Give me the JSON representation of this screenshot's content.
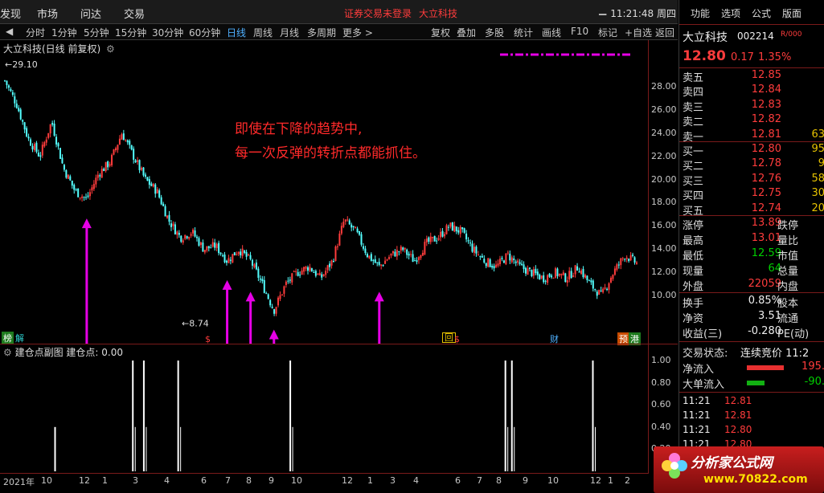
{
  "topbar": {
    "menus": [
      "发现",
      "市场",
      "问达",
      "交易"
    ],
    "notice_login": "证券交易未登录",
    "notice_stock": "大立科技",
    "clock": "11:21:48 周四"
  },
  "periodbar": {
    "periods": [
      "分时",
      "1分钟",
      "5分钟",
      "15分钟",
      "30分钟",
      "60分钟",
      "日线",
      "周线",
      "月线",
      "多周期",
      "更多 >"
    ],
    "active": "日线",
    "tools": [
      "复权",
      "叠加",
      "多股",
      "统计",
      "画线",
      "F10",
      "标记",
      "+自选",
      "返回"
    ]
  },
  "chart": {
    "title": "大立科技(日线 前复权)",
    "high_label": "29.10",
    "low_label": "8.74",
    "annotation_line1": "即使在下降的趋势中,",
    "annotation_line2": "每一次反弹的转折点都能抓住。",
    "yticks": [
      "28.00",
      "26.00",
      "24.00",
      "22.00",
      "20.00",
      "18.00",
      "16.00",
      "14.00",
      "12.00",
      "10.00"
    ],
    "sub_title": "建仓点副图  建仓点: 0.00",
    "sub_yticks": [
      "1.00",
      "0.80",
      "0.60",
      "0.40",
      "0.20"
    ],
    "xticks": [
      "2021年",
      "10",
      "12",
      "1",
      "3",
      "4",
      "6",
      "7",
      "8",
      "9",
      "10",
      "12",
      "1",
      "3",
      "4",
      "6",
      "7",
      "8",
      "9",
      "10",
      "12",
      "1",
      "2"
    ],
    "tags": {
      "left1": "榜",
      "left2": "解",
      "mid1": "$",
      "mid2": "回",
      "mid3": "$",
      "cai": "财",
      "yu": "预",
      "gang": "港"
    },
    "colors": {
      "up": "#ff3c3c",
      "down": "#54ffff",
      "arrow": "#e600e6",
      "annotation": "#ff2a2a"
    }
  },
  "chart_data": {
    "type": "line",
    "title": "大立科技(日线 前复权)",
    "xlabel": "",
    "ylabel": "",
    "ylim": [
      8.5,
      29.5
    ],
    "x_ticks": [
      "2021年",
      "10",
      "12",
      "1",
      "3",
      "4",
      "6",
      "7",
      "8",
      "9",
      "10",
      "12",
      "1",
      "3",
      "4",
      "6",
      "7",
      "8",
      "9",
      "10",
      "12",
      "1",
      "2"
    ],
    "price_path": [
      28.5,
      26.5,
      23.5,
      22.0,
      25.0,
      21.0,
      19.0,
      18.3,
      20.5,
      21.5,
      24.0,
      22.0,
      20.0,
      19.0,
      16.5,
      15.0,
      15.5,
      14.0,
      14.3,
      13.0,
      14.0,
      13.0,
      11.0,
      8.74,
      11.0,
      12.0,
      12.5,
      11.5,
      13.0,
      16.5,
      15.5,
      13.5,
      12.5,
      13.5,
      14.0,
      13.0,
      14.5,
      15.0,
      16.0,
      15.5,
      14.0,
      13.0,
      12.5,
      13.5,
      12.5,
      12.0,
      11.5,
      12.0,
      11.5,
      12.5,
      11.0,
      10.0,
      12.0,
      13.5,
      12.8
    ],
    "buy_signals": [
      {
        "bar": 7,
        "price": 18.3
      },
      {
        "bar": 19,
        "price": 13.0
      },
      {
        "bar": 21,
        "price": 12.0
      },
      {
        "bar": 23,
        "price": 8.74
      },
      {
        "bar": 32,
        "price": 12.0
      }
    ],
    "sub_chart_series": {
      "name": "建仓点",
      "spikes": [
        {
          "pos": 0.085,
          "value": 0.4
        },
        {
          "pos": 0.205,
          "value": 1.0
        },
        {
          "pos": 0.222,
          "value": 1.0
        },
        {
          "pos": 0.275,
          "value": 1.0
        },
        {
          "pos": 0.448,
          "value": 1.0
        },
        {
          "pos": 0.78,
          "value": 1.0
        },
        {
          "pos": 0.79,
          "value": 1.0
        },
        {
          "pos": 0.915,
          "value": 1.0
        }
      ]
    }
  },
  "rpanel": {
    "menus": [
      "功能",
      "选项",
      "公式",
      "版面"
    ],
    "stock_name": "大立科技",
    "stock_code": "002214",
    "price": "12.80",
    "change": "0.17",
    "change_pct": "1.35%",
    "asks": [
      {
        "label": "卖五",
        "price": "12.85",
        "vol": ""
      },
      {
        "label": "卖四",
        "price": "12.84",
        "vol": ""
      },
      {
        "label": "卖三",
        "price": "12.83",
        "vol": ""
      },
      {
        "label": "卖二",
        "price": "12.82",
        "vol": ""
      },
      {
        "label": "卖一",
        "price": "12.81",
        "vol": "63"
      }
    ],
    "bids": [
      {
        "label": "买一",
        "price": "12.80",
        "vol": "95"
      },
      {
        "label": "买二",
        "price": "12.78",
        "vol": "9"
      },
      {
        "label": "买三",
        "price": "12.76",
        "vol": "58"
      },
      {
        "label": "买四",
        "price": "12.75",
        "vol": "30"
      },
      {
        "label": "买五",
        "price": "12.74",
        "vol": "20"
      }
    ],
    "stats": [
      {
        "l1": "涨停",
        "v1": "13.89",
        "c1": "red",
        "l2": "跌停"
      },
      {
        "l1": "最高",
        "v1": "13.01",
        "c1": "red",
        "l2": "量比"
      },
      {
        "l1": "最低",
        "v1": "12.59",
        "c1": "green",
        "l2": "市值"
      },
      {
        "l1": "现量",
        "v1": "64",
        "c1": "green",
        "l2": "总量"
      },
      {
        "l1": "外盘",
        "v1": "22059",
        "c1": "red",
        "l2": "内盘"
      }
    ],
    "stats2": [
      {
        "l1": "换手",
        "v1": "0.85%",
        "l2": "股本"
      },
      {
        "l1": "净资",
        "v1": "3.51",
        "l2": "流通"
      },
      {
        "l1": "收益(三)",
        "v1": "-0.280",
        "l2": "PE(动)"
      }
    ],
    "trade_status_label": "交易状态:",
    "trade_status": "连续竞价 11:2",
    "net_inflow_label": "净流入",
    "net_inflow": "195.",
    "big_inflow_label": "大单流入",
    "big_inflow": "-90.",
    "ticks": [
      {
        "t": "11:21",
        "p": "12.81"
      },
      {
        "t": "11:21",
        "p": "12.81"
      },
      {
        "t": "11:21",
        "p": "12.80"
      },
      {
        "t": "11:21",
        "p": "12.80"
      }
    ]
  },
  "logo": {
    "brand": "分析家公式网",
    "url": "www.70822.com"
  }
}
